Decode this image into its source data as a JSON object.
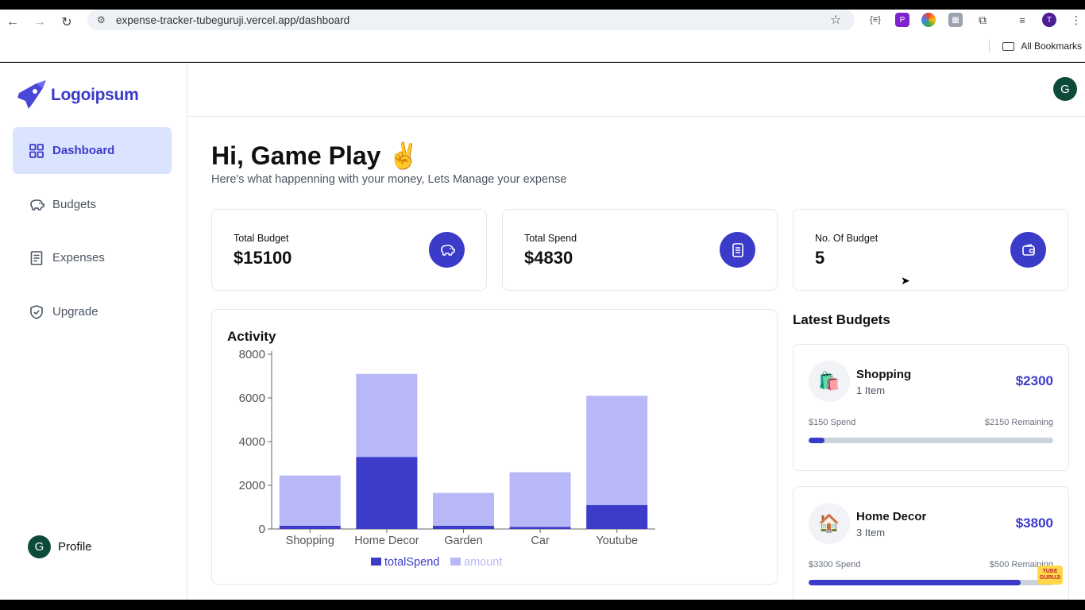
{
  "browser": {
    "url": "expense-tracker-tubeguruji.vercel.app/dashboard",
    "bookmarks_label": "All Bookmarks",
    "profile_initial": "T"
  },
  "sidebar": {
    "logo_text": "Logoipsum",
    "items": [
      {
        "label": "Dashboard",
        "icon": "grid-icon",
        "active": true
      },
      {
        "label": "Budgets",
        "icon": "piggy-bank-icon",
        "active": false
      },
      {
        "label": "Expenses",
        "icon": "receipt-icon",
        "active": false
      },
      {
        "label": "Upgrade",
        "icon": "shield-check-icon",
        "active": false
      }
    ],
    "profile": {
      "initial": "G",
      "label": "Profile"
    }
  },
  "header": {
    "avatar_initial": "G"
  },
  "main": {
    "greeting": "Hi, Game Play ✌️",
    "subtitle": "Here's what happenning with your money, Lets Manage your expense",
    "stats": [
      {
        "label": "Total Budget",
        "value": "$15100",
        "icon": "piggy-bank-icon"
      },
      {
        "label": "Total Spend",
        "value": "$4830",
        "icon": "receipt-icon"
      },
      {
        "label": "No. Of Budget",
        "value": "5",
        "icon": "wallet-icon"
      }
    ],
    "activity_title": "Activity",
    "latest_title": "Latest Budgets",
    "budgets": [
      {
        "name": "Shopping",
        "items": "1 Item",
        "amount": "$2300",
        "emoji": "🛍️",
        "spent": "$150 Spend",
        "remaining": "$2150 Remaining",
        "progress": 0.065
      },
      {
        "name": "Home Decor",
        "items": "3 Item",
        "amount": "$3800",
        "emoji": "🏠",
        "spent": "$3300 Spend",
        "remaining": "$500 Remaining",
        "progress": 0.868
      }
    ]
  },
  "watermark_text": "TUBE GURUJI",
  "chart_data": {
    "type": "bar",
    "stacked": true,
    "categories": [
      "Shopping",
      "Home Decor",
      "Garden",
      "Car",
      "Youtube"
    ],
    "series": [
      {
        "name": "totalSpend",
        "values": [
          150,
          3300,
          150,
          100,
          1100
        ],
        "color": "#3d3cca"
      },
      {
        "name": "amount",
        "values": [
          2300,
          3800,
          1500,
          2500,
          5000
        ],
        "color": "#b8b8f8"
      }
    ],
    "yticks": [
      0,
      2000,
      4000,
      6000,
      8000
    ],
    "ylim": [
      0,
      8000
    ],
    "legend": "bottom",
    "grid": false
  }
}
